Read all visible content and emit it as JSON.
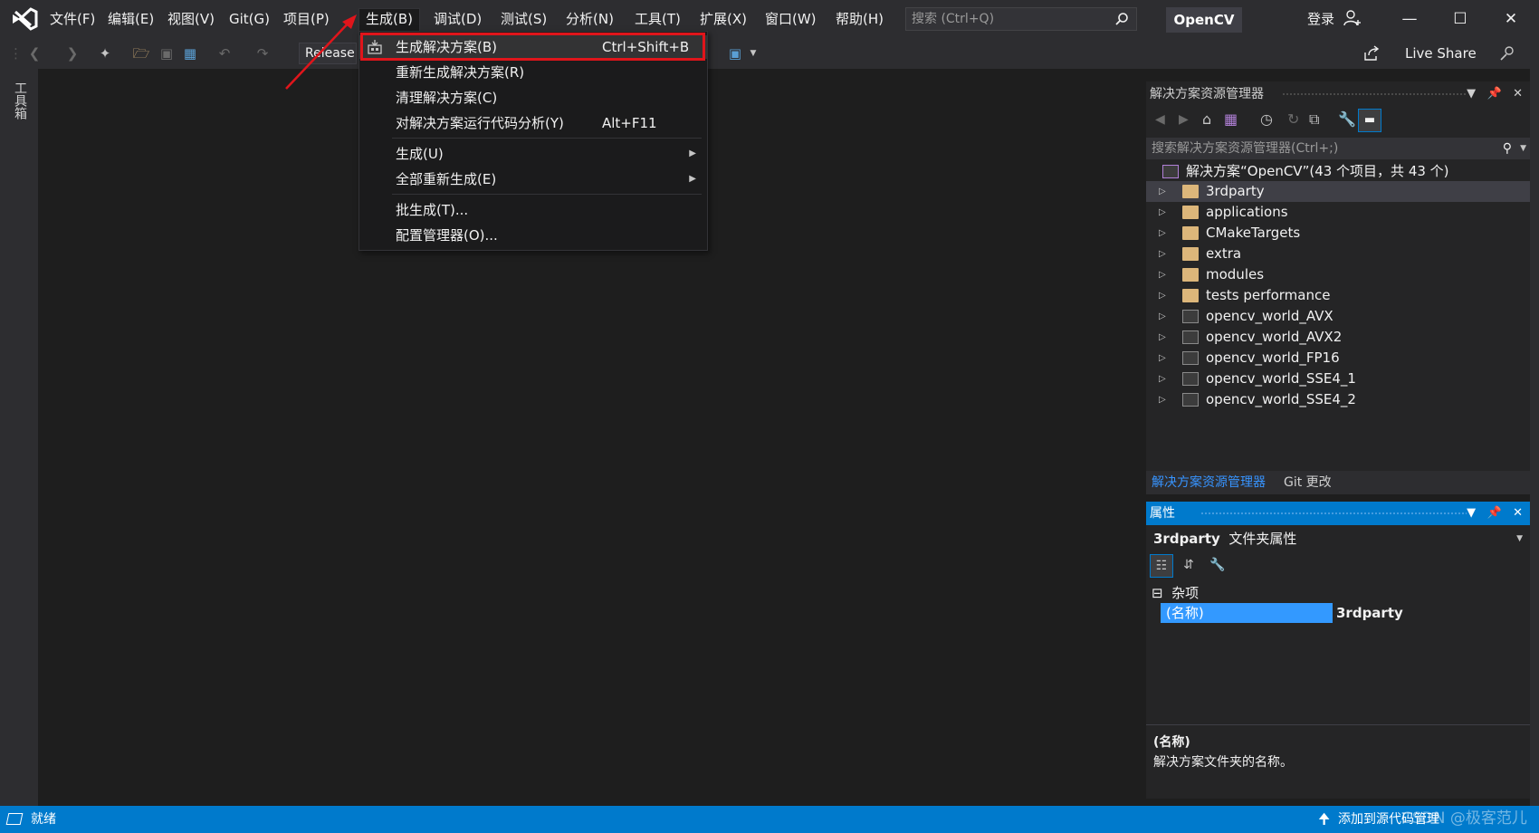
{
  "app": {
    "project_name": "OpenCV",
    "search_placeholder": "搜索 (Ctrl+Q)",
    "login": "登录",
    "live_share": "Live Share"
  },
  "menu": [
    {
      "label": "文件(F)"
    },
    {
      "label": "编辑(E)"
    },
    {
      "label": "视图(V)"
    },
    {
      "label": "Git(G)"
    },
    {
      "label": "项目(P)"
    },
    {
      "label": "生成(B)",
      "active": true
    },
    {
      "label": "调试(D)"
    },
    {
      "label": "测试(S)"
    },
    {
      "label": "分析(N)"
    },
    {
      "label": "工具(T)"
    },
    {
      "label": "扩展(X)"
    },
    {
      "label": "窗口(W)"
    },
    {
      "label": "帮助(H)"
    }
  ],
  "toolbar": {
    "config": "Release"
  },
  "left_strip": {
    "toolbox": "工具箱"
  },
  "build_menu": {
    "items": [
      {
        "label": "生成解决方案(B)",
        "shortcut": "Ctrl+Shift+B"
      },
      {
        "label": "重新生成解决方案(R)",
        "shortcut": ""
      },
      {
        "label": "清理解决方案(C)",
        "shortcut": ""
      },
      {
        "label": "对解决方案运行代码分析(Y)",
        "shortcut": "Alt+F11"
      },
      {
        "label": "生成(U)",
        "submenu": true
      },
      {
        "label": "全部重新生成(E)",
        "submenu": true
      },
      {
        "label": "批生成(T)...",
        "shortcut": ""
      },
      {
        "label": "配置管理器(O)...",
        "shortcut": ""
      }
    ]
  },
  "solution_explorer": {
    "title": "解决方案资源管理器",
    "search_placeholder": "搜索解决方案资源管理器(Ctrl+;)",
    "solution": "解决方案“OpenCV”(43 个项目，共 43 个)",
    "items": [
      {
        "label": "3rdparty",
        "type": "folder",
        "selected": true
      },
      {
        "label": "applications",
        "type": "folder"
      },
      {
        "label": "CMakeTargets",
        "type": "folder"
      },
      {
        "label": "extra",
        "type": "folder"
      },
      {
        "label": "modules",
        "type": "folder"
      },
      {
        "label": "tests performance",
        "type": "folder"
      },
      {
        "label": "opencv_world_AVX",
        "type": "project"
      },
      {
        "label": "opencv_world_AVX2",
        "type": "project"
      },
      {
        "label": "opencv_world_FP16",
        "type": "project"
      },
      {
        "label": "opencv_world_SSE4_1",
        "type": "project"
      },
      {
        "label": "opencv_world_SSE4_2",
        "type": "project"
      }
    ],
    "tabs": [
      "解决方案资源管理器",
      "Git 更改"
    ]
  },
  "properties": {
    "title": "属性",
    "object_name": "3rdparty",
    "object_type": "文件夹属性",
    "category": "杂项",
    "row_name": "(名称)",
    "row_value": "3rdparty",
    "desc_title": "(名称)",
    "desc_text": "解决方案文件夹的名称。"
  },
  "status": {
    "text": "就绪",
    "source_control": "添加到源代码管理",
    "watermark": "CSDN @极客范儿"
  },
  "colors": {
    "accent": "#007acc",
    "highlight_box": "#e0151b",
    "link": "#3794ff"
  }
}
